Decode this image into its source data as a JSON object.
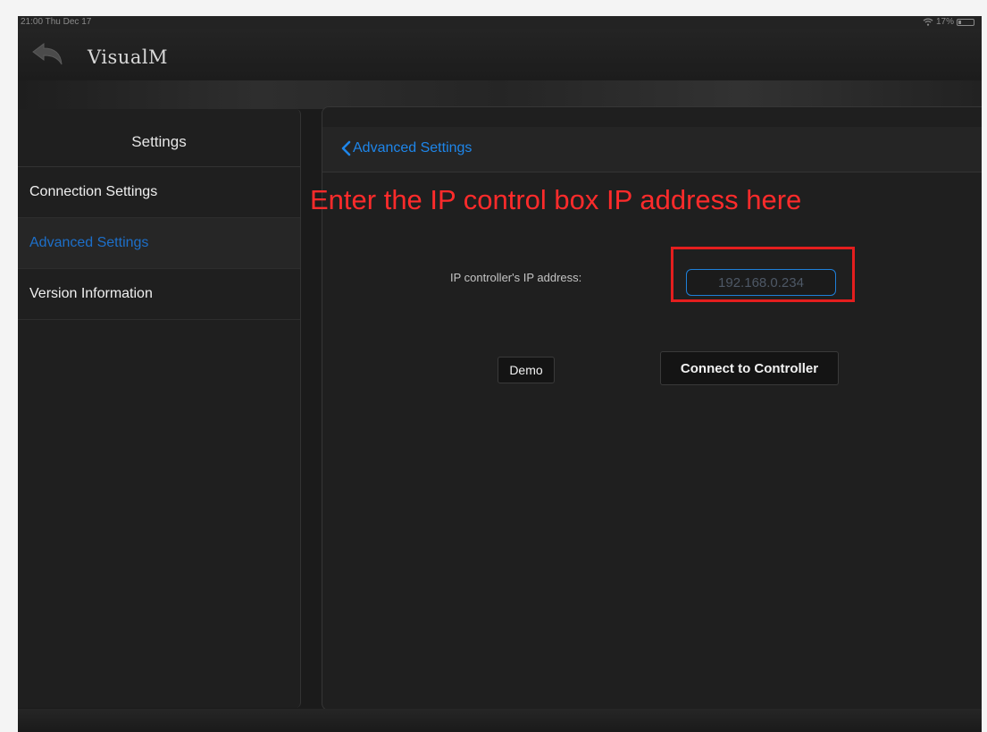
{
  "status_bar": {
    "time": "21:00",
    "date": "Thu Dec 17",
    "battery": "17%",
    "battery_level": 0.17
  },
  "app": {
    "title": "VisualM"
  },
  "sidebar": {
    "title": "Settings",
    "items": [
      {
        "label": "Connection Settings",
        "active": false
      },
      {
        "label": "Advanced Settings",
        "active": true
      },
      {
        "label": "Version Information",
        "active": false
      }
    ]
  },
  "detail": {
    "back_label": "Advanced Settings",
    "annotation": "Enter the IP control box IP address here",
    "ip_label": "IP controller's IP address:",
    "ip_placeholder": "192.168.0.234",
    "demo_label": "Demo",
    "connect_label": "Connect to Controller"
  },
  "colors": {
    "accent": "#1e86ea",
    "annotation": "#ff2b2b",
    "background": "#1f1f1f"
  }
}
